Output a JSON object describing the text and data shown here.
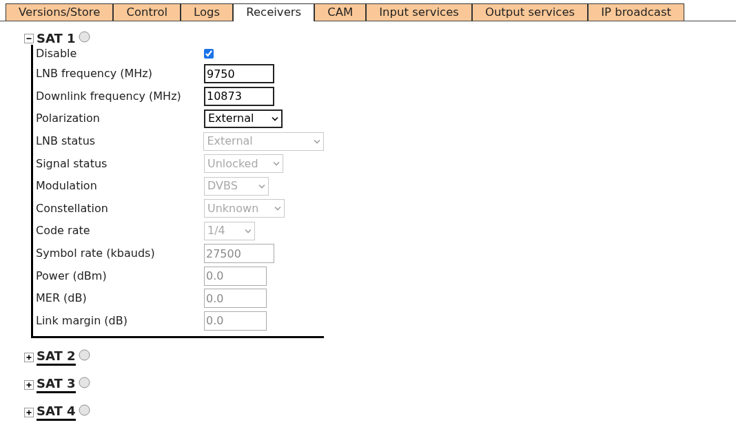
{
  "tabs": [
    {
      "label": "Versions/Store",
      "selected": false
    },
    {
      "label": "Control",
      "selected": false
    },
    {
      "label": "Logs",
      "selected": false
    },
    {
      "label": "Receivers",
      "selected": true
    },
    {
      "label": "CAM",
      "selected": false
    },
    {
      "label": "Input services",
      "selected": false
    },
    {
      "label": "Output services",
      "selected": false
    },
    {
      "label": "IP broadcast",
      "selected": false
    }
  ],
  "receivers": [
    {
      "title": "SAT 1",
      "expanded": true,
      "fields": [
        {
          "kind": "checkbox",
          "label": "Disable",
          "checked": true
        },
        {
          "kind": "input",
          "label": "LNB frequency (MHz)",
          "value": "9750",
          "disabled": false
        },
        {
          "kind": "input",
          "label": "Downlink frequency (MHz)",
          "value": "10873",
          "disabled": false
        },
        {
          "kind": "select",
          "label": "Polarization",
          "value": "External",
          "disabled": false
        },
        {
          "kind": "select",
          "label": "LNB status",
          "value": "External",
          "disabled": true
        },
        {
          "kind": "select",
          "label": "Signal status",
          "value": "Unlocked",
          "disabled": true
        },
        {
          "kind": "select",
          "label": "Modulation",
          "value": "DVBS",
          "disabled": true
        },
        {
          "kind": "select",
          "label": "Constellation",
          "value": "Unknown",
          "disabled": true
        },
        {
          "kind": "select",
          "label": "Code rate",
          "value": "1/4",
          "disabled": true
        },
        {
          "kind": "input",
          "label": "Symbol rate (kbauds)",
          "value": "27500",
          "disabled": true
        },
        {
          "kind": "input",
          "label": "Power (dBm)",
          "value": "0.0",
          "disabled": true
        },
        {
          "kind": "input",
          "label": "MER (dB)",
          "value": "0.0",
          "disabled": true
        },
        {
          "kind": "input",
          "label": "Link margin (dB)",
          "value": "0.0",
          "disabled": true
        }
      ]
    },
    {
      "title": "SAT 2",
      "expanded": false
    },
    {
      "title": "SAT 3",
      "expanded": false
    },
    {
      "title": "SAT 4",
      "expanded": false
    }
  ]
}
